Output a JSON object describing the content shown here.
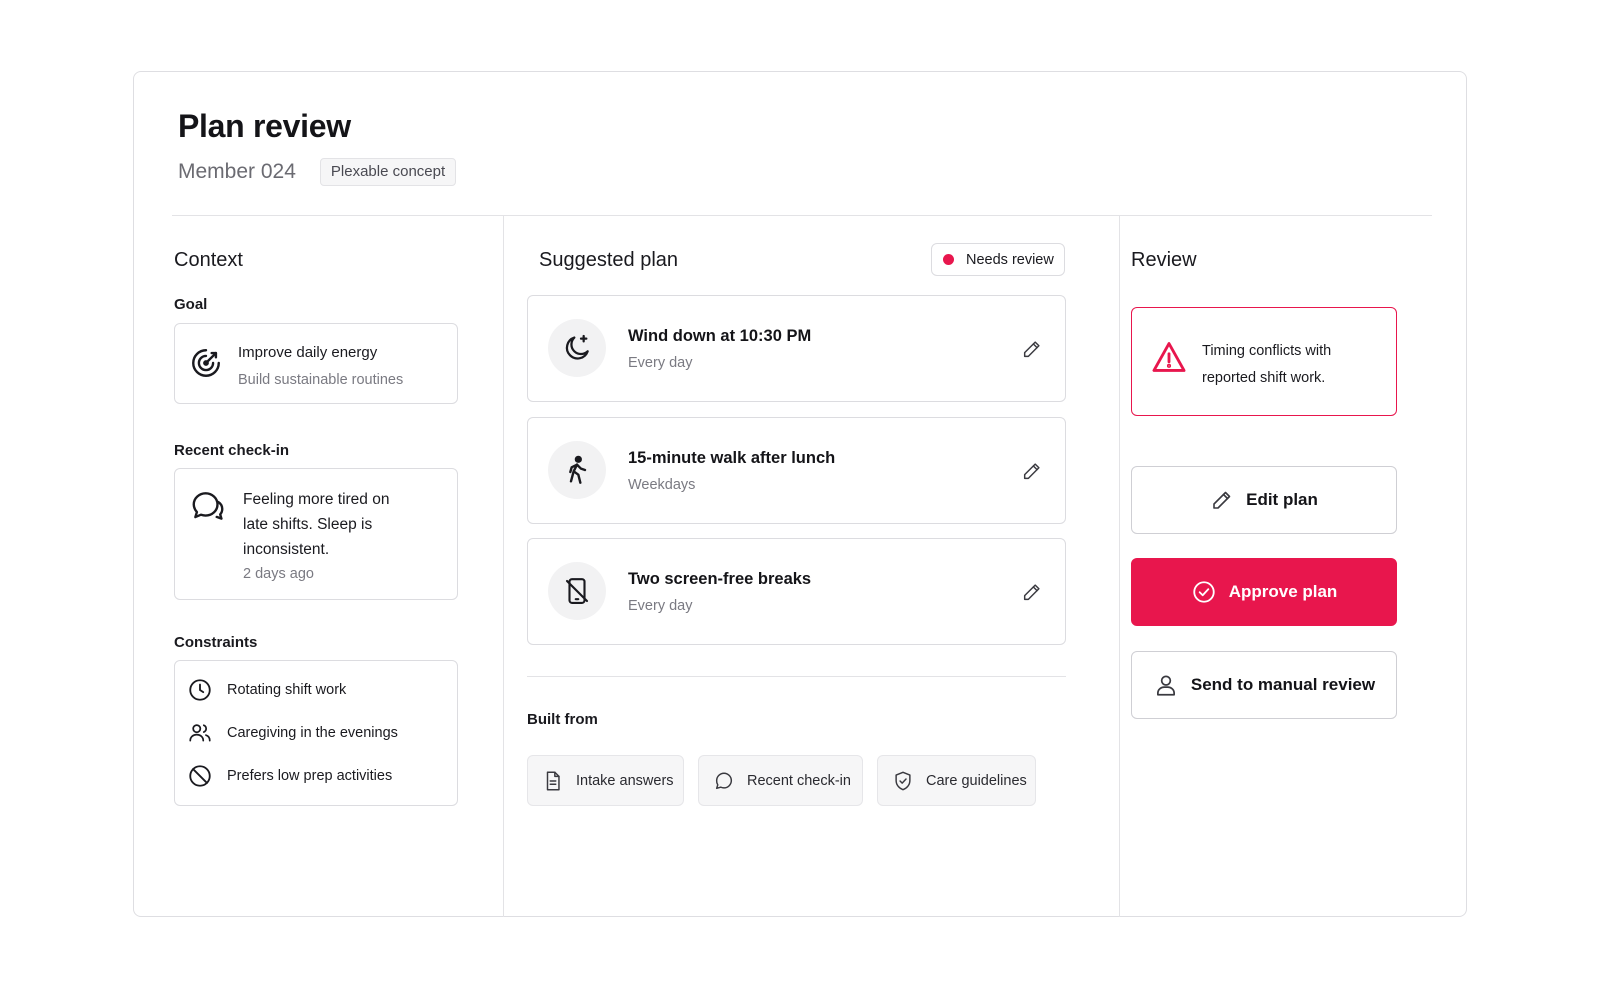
{
  "header": {
    "title": "Plan review",
    "member": "Member 024",
    "badge": "Plexable concept"
  },
  "context": {
    "title": "Context",
    "goal": {
      "label": "Goal",
      "primary": "Improve daily energy",
      "secondary": "Build sustainable routines",
      "icon": "target-icon"
    },
    "checkin": {
      "label": "Recent check-in",
      "text": "Feeling more tired on late shifts. Sleep is inconsistent.",
      "time": "2 days ago",
      "icon": "chat-bubbles-icon"
    },
    "constraints": {
      "label": "Constraints",
      "items": [
        {
          "label": "Rotating shift work",
          "icon": "clock-icon"
        },
        {
          "label": "Caregiving in the evenings",
          "icon": "people-icon"
        },
        {
          "label": "Prefers low prep activities",
          "icon": "ban-icon"
        }
      ]
    }
  },
  "plan": {
    "title": "Suggested plan",
    "status": "Needs review",
    "status_color": "#e8164d",
    "items": [
      {
        "title": "Wind down at 10:30 PM",
        "sub": "Every day",
        "icon": "moon-icon"
      },
      {
        "title": "15-minute walk after lunch",
        "sub": "Weekdays",
        "icon": "walking-icon"
      },
      {
        "title": "Two screen-free breaks",
        "sub": "Every day",
        "icon": "no-phone-icon"
      }
    ],
    "built_from": {
      "label": "Built from",
      "sources": [
        {
          "label": "Intake answers",
          "icon": "document-icon"
        },
        {
          "label": "Recent check-in",
          "icon": "chat-icon"
        },
        {
          "label": "Care guidelines",
          "icon": "shield-check-icon"
        }
      ]
    }
  },
  "review": {
    "title": "Review",
    "alert": "Timing conflicts with reported shift work.",
    "alert_color": "#e8164d",
    "edit_label": "Edit plan",
    "approve_label": "Approve plan",
    "manual_label": "Send to manual review",
    "accent_color": "#e8164d"
  }
}
